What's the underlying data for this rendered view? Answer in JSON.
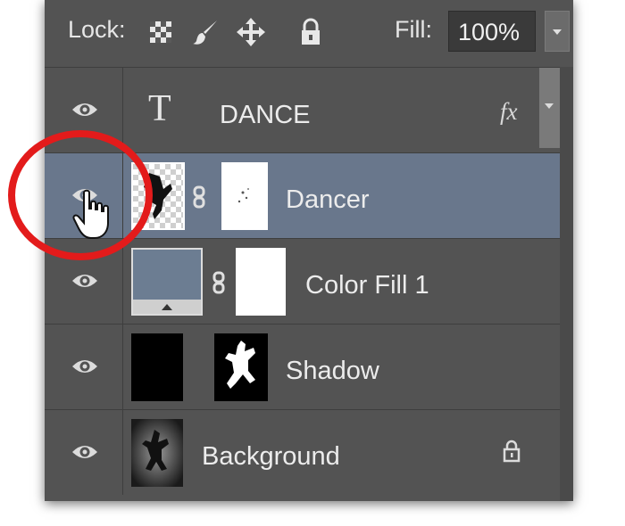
{
  "toolbar": {
    "lock_label": "Lock:",
    "lock_icons": [
      "lock-transparent-pixels-icon",
      "lock-image-pixels-icon",
      "lock-position-icon",
      "lock-all-icon"
    ],
    "fill_label": "Fill:",
    "fill_value": "100%"
  },
  "layers": [
    {
      "name": "DANCE",
      "type": "text",
      "visible": true,
      "effects": "fx",
      "selected": false
    },
    {
      "name": "Dancer",
      "type": "image-with-mask",
      "visible": true,
      "selected": true
    },
    {
      "name": "Color Fill 1",
      "type": "fill-with-mask",
      "visible": true,
      "selected": false
    },
    {
      "name": "Shadow",
      "type": "image-with-mask",
      "visible": true,
      "selected": false
    },
    {
      "name": "Background",
      "type": "background",
      "visible": true,
      "locked": true,
      "selected": false
    }
  ],
  "colors": {
    "panel": "#535353",
    "selected_row": "#69778c",
    "color_fill_swatch": "#6c7d92",
    "annotation": "#e31b1b"
  },
  "annotation": {
    "shape": "circle",
    "target": "eye-icon"
  }
}
